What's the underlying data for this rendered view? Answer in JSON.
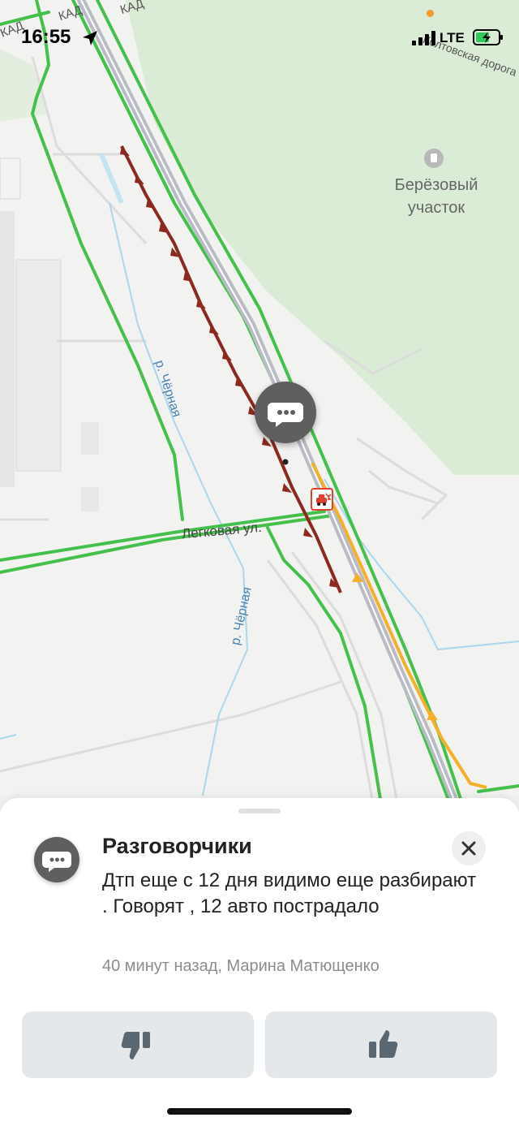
{
  "status_bar": {
    "time": "16:55",
    "network": "LTE"
  },
  "map": {
    "labels": {
      "kad_1": "КАД",
      "kad_2": "КАД",
      "kad_3": "КАД",
      "koltovskaya": "Колтовская дорога",
      "forest": "Берёзовый участок",
      "river_1": "р. Чёрная",
      "river_2": "р. Чёрная",
      "street": "Легковая ул."
    },
    "colors": {
      "background": "#f2f3f1",
      "forest": "#daecd5",
      "road_green": "#45c04d",
      "traffic_jam": "#8b2a20",
      "traffic_yellow": "#f2b02b",
      "water": "#aad6ee"
    }
  },
  "sheet": {
    "title": "Разговорчики",
    "text": "Дтп еще с 12 дня видимо еще разбирают . Говорят , 12 авто пострадало",
    "meta": "40 минут назад, Марина Матющенко",
    "icons": {
      "chat": "chat-bubble-icon",
      "close": "close-icon",
      "dislike": "thumbs-down-icon",
      "like": "thumbs-up-icon"
    }
  }
}
